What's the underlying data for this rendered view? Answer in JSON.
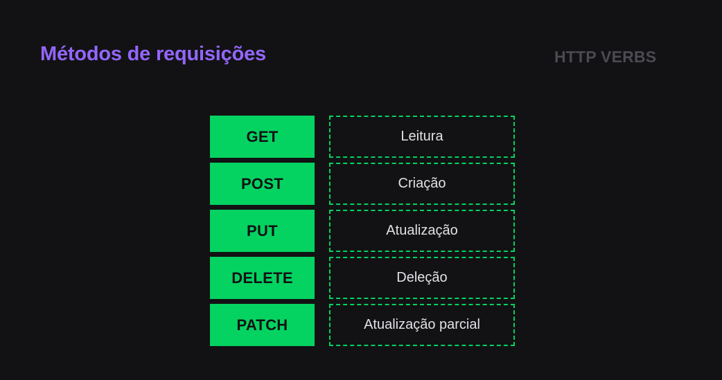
{
  "header": {
    "title": "Métodos de requisições",
    "subtitle": "HTTP VERBS"
  },
  "methods": [
    {
      "verb": "GET",
      "description": "Leitura"
    },
    {
      "verb": "POST",
      "description": "Criação"
    },
    {
      "verb": "PUT",
      "description": "Atualização"
    },
    {
      "verb": "DELETE",
      "description": "Deleção"
    },
    {
      "verb": "PATCH",
      "description": "Atualização parcial"
    }
  ],
  "colors": {
    "background": "#121214",
    "title": "#9466ff",
    "subtitle": "#4a4a52",
    "accent_green": "#04d361",
    "description_text": "#e1e1e6"
  }
}
